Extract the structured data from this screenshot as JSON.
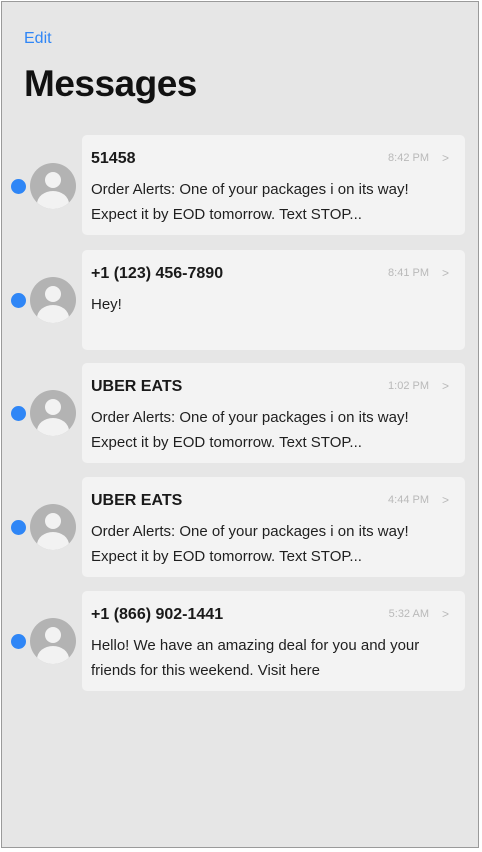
{
  "header": {
    "edit_label": "Edit",
    "title": "Messages"
  },
  "conversations": [
    {
      "sender": "51458",
      "time": "8:42 PM",
      "preview": "Order Alerts: One of your packages i on its way! Expect it by EOD tomorrow. Text STOP...",
      "unread": true
    },
    {
      "sender": "+1 (123) 456-7890",
      "time": "8:41 PM",
      "preview": "Hey!",
      "unread": true
    },
    {
      "sender": "UBER EATS",
      "time": "1:02 PM",
      "preview": "Order Alerts: One of your packages i on its way! Expect it by EOD tomorrow. Text STOP...",
      "unread": true
    },
    {
      "sender": "UBER EATS",
      "time": "4:44 PM",
      "preview": "Order Alerts: One of your packages i on its way! Expect it by EOD tomorrow. Text STOP...",
      "unread": true
    },
    {
      "sender": "+1 (866) 902-1441",
      "time": "5:32 AM",
      "preview": "Hello! We have an amazing deal for you and your friends for this weekend. Visit here",
      "unread": true
    }
  ],
  "icons": {
    "chevron": ">",
    "unread_dot_color": "#2f86f6",
    "accent": "#2f86f6"
  }
}
